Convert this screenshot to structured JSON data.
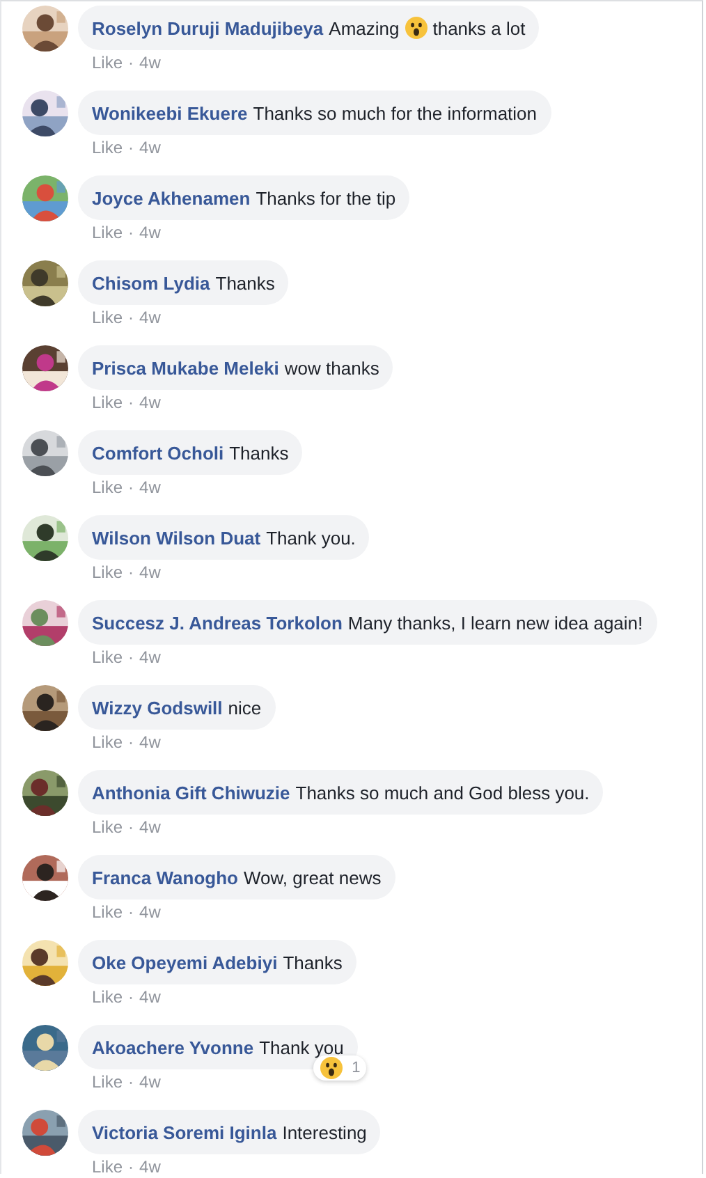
{
  "comments": [
    {
      "author": "Roselyn Duruji Madujibeya",
      "segments": [
        {
          "kind": "text",
          "text": "Amazing"
        },
        {
          "kind": "emoji"
        },
        {
          "kind": "text",
          "text": "thanks a lot"
        }
      ],
      "like": "Like",
      "separator": "·",
      "time": "4w"
    },
    {
      "author": "Wonikeebi Ekuere",
      "segments": [
        {
          "kind": "text",
          "text": "Thanks so much for the information"
        }
      ],
      "like": "Like",
      "separator": "·",
      "time": "4w"
    },
    {
      "author": "Joyce Akhenamen",
      "segments": [
        {
          "kind": "text",
          "text": "Thanks for the tip"
        }
      ],
      "like": "Like",
      "separator": "·",
      "time": "4w"
    },
    {
      "author": "Chisom Lydia",
      "segments": [
        {
          "kind": "text",
          "text": "Thanks"
        }
      ],
      "like": "Like",
      "separator": "·",
      "time": "4w"
    },
    {
      "author": "Prisca Mukabe Meleki",
      "segments": [
        {
          "kind": "text",
          "text": "wow thanks"
        }
      ],
      "like": "Like",
      "separator": "·",
      "time": "4w"
    },
    {
      "author": "Comfort Ocholi",
      "segments": [
        {
          "kind": "text",
          "text": "Thanks"
        }
      ],
      "like": "Like",
      "separator": "·",
      "time": "4w"
    },
    {
      "author": "Wilson Wilson Duat",
      "segments": [
        {
          "kind": "text",
          "text": "Thank you."
        }
      ],
      "like": "Like",
      "separator": "·",
      "time": "4w"
    },
    {
      "author": "Succesz J. Andreas Torkolon",
      "segments": [
        {
          "kind": "text",
          "text": "Many thanks, I learn new idea again!"
        }
      ],
      "like": "Like",
      "separator": "·",
      "time": "4w"
    },
    {
      "author": "Wizzy Godswill",
      "segments": [
        {
          "kind": "text",
          "text": "nice"
        }
      ],
      "like": "Like",
      "separator": "·",
      "time": "4w"
    },
    {
      "author": "Anthonia Gift Chiwuzie",
      "segments": [
        {
          "kind": "text",
          "text": "Thanks so much and God bless you."
        }
      ],
      "like": "Like",
      "separator": "·",
      "time": "4w"
    },
    {
      "author": "Franca Wanogho",
      "segments": [
        {
          "kind": "text",
          "text": "Wow, great news"
        }
      ],
      "like": "Like",
      "separator": "·",
      "time": "4w"
    },
    {
      "author": "Oke Opeyemi Adebiyi",
      "segments": [
        {
          "kind": "text",
          "text": "Thanks"
        }
      ],
      "like": "Like",
      "separator": "·",
      "time": "4w"
    },
    {
      "author": "Akoachere Yvonne",
      "segments": [
        {
          "kind": "text",
          "text": "Thank you"
        }
      ],
      "like": "Like",
      "separator": "·",
      "time": "4w",
      "reaction": {
        "count": "1"
      }
    },
    {
      "author": "Victoria Soremi Iginla",
      "segments": [
        {
          "kind": "text",
          "text": "Interesting"
        }
      ],
      "like": "Like",
      "separator": "·",
      "time": "4w"
    }
  ]
}
